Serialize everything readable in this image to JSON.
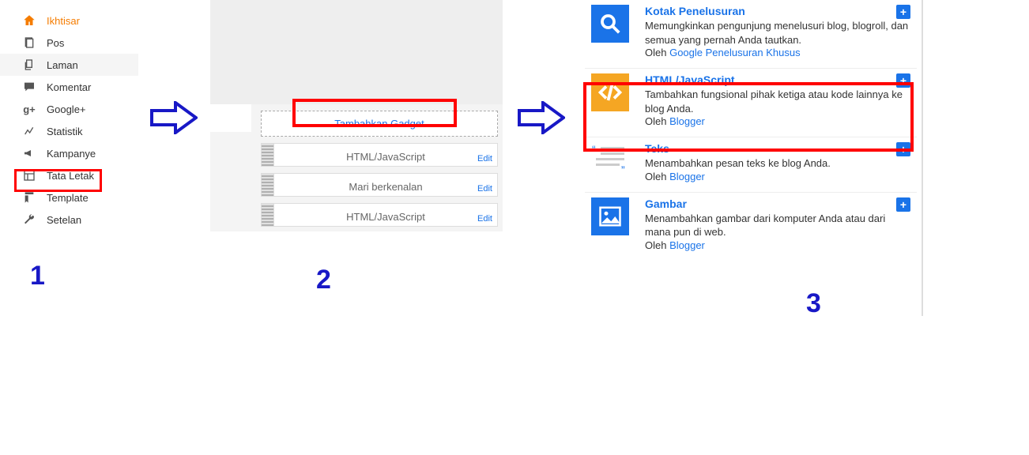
{
  "sidebar": {
    "items": [
      {
        "label": "Ikhtisar"
      },
      {
        "label": "Pos"
      },
      {
        "label": "Laman"
      },
      {
        "label": "Komentar"
      },
      {
        "label": "Google+"
      },
      {
        "label": "Statistik"
      },
      {
        "label": "Kampanye"
      },
      {
        "label": "Tata Letak"
      },
      {
        "label": "Template"
      },
      {
        "label": "Setelan"
      }
    ]
  },
  "layout": {
    "add_gadget": "Tambahkan Gadget",
    "widgets": [
      {
        "title": "HTML/JavaScript",
        "edit": "Edit"
      },
      {
        "title": "Mari berkenalan",
        "edit": "Edit"
      },
      {
        "title": "HTML/JavaScript",
        "edit": "Edit"
      }
    ]
  },
  "gadgets": {
    "plus": "+",
    "by_prefix": "Oleh ",
    "items": [
      {
        "title": "Kotak Penelusuran",
        "desc": "Memungkinkan pengunjung menelusuri blog, blogroll, dan semua yang pernah Anda tautkan.",
        "by": "Google Penelusuran Khusus",
        "color": "#1a73e8"
      },
      {
        "title": "HTML/JavaScript",
        "desc": "Tambahkan fungsional pihak ketiga atau kode lainnya ke blog Anda.",
        "by": "Blogger",
        "color": "#f5a623"
      },
      {
        "title": "Teks",
        "desc": "Menambahkan pesan teks ke blog Anda.",
        "by": "Blogger",
        "color": "#e8eaed"
      },
      {
        "title": "Gambar",
        "desc": "Menambahkan gambar dari komputer Anda atau dari mana pun di web.",
        "by": "Blogger",
        "color": "#1a73e8"
      }
    ]
  },
  "steps": {
    "s1": "1",
    "s2": "2",
    "s3": "3"
  }
}
